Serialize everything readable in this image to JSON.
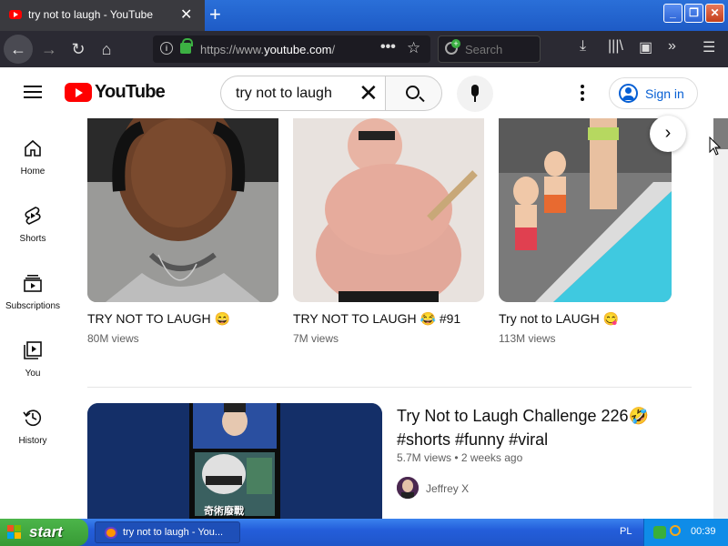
{
  "browser": {
    "tab_title": "try not to laugh - YouTube",
    "tab_close": "✕",
    "new_tab": "+",
    "url_prefix": "https://www.",
    "url_domain": "youtube.com",
    "url_rest": "/",
    "search_placeholder": "Search",
    "window_buttons": [
      "_",
      "❐",
      "✕"
    ]
  },
  "header": {
    "logo_text": "YouTube",
    "search_query": "try not to laugh",
    "sign_in_label": "Sign in"
  },
  "guide": {
    "items": [
      {
        "label": "Home",
        "icon": "home-icon"
      },
      {
        "label": "Shorts",
        "icon": "shorts-icon"
      },
      {
        "label": "Subscriptions",
        "icon": "subscriptions-icon"
      },
      {
        "label": "You",
        "icon": "you-icon"
      },
      {
        "label": "History",
        "icon": "history-icon"
      }
    ]
  },
  "shorts": [
    {
      "title": "TRY NOT TO LAUGH 😄",
      "views": "80M views"
    },
    {
      "title": "TRY NOT TO LAUGH 😂 #91",
      "views": "7M views"
    },
    {
      "title": "Try not to LAUGH 😋",
      "views": "113M views"
    }
  ],
  "video": {
    "title_line1": "Try Not to Laugh Challenge 226🤣",
    "title_line2": "#shorts #funny #viral",
    "meta": "5.7M views • 2 weeks ago",
    "channel": "Jeffrey X",
    "thumb_text": "奇術廢戰"
  },
  "taskbar": {
    "start_label": "start",
    "task_label": "try not to laugh - You...",
    "language": "PL",
    "clock": "00:39"
  },
  "colors": {
    "youtube_red": "#ff0000",
    "link_blue": "#065fd4",
    "firefox_toolbar": "#2b2a33",
    "xp_taskbar": "#245edb",
    "xp_start": "#379a35"
  }
}
